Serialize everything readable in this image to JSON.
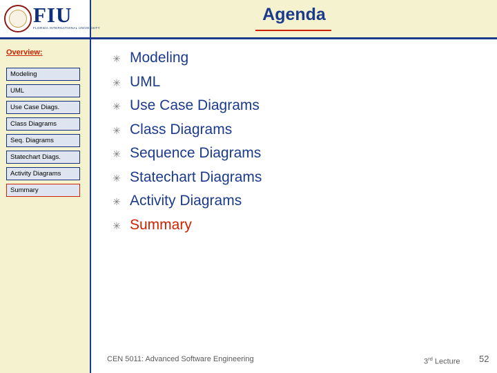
{
  "header": {
    "title": "Agenda",
    "logo": {
      "initials": "FIU",
      "subtitle": "FLORIDA INTERNATIONAL UNIVERSITY",
      "seal_name": "fiu-seal"
    }
  },
  "sidebar": {
    "heading": "Overview:",
    "items": [
      {
        "label": "Modeling",
        "current": false
      },
      {
        "label": "UML",
        "current": false
      },
      {
        "label": "Use Case Diags.",
        "current": false
      },
      {
        "label": "Class Diagrams",
        "current": false
      },
      {
        "label": "Seq. Diagrams",
        "current": false
      },
      {
        "label": "Statechart Diags.",
        "current": false
      },
      {
        "label": "Activity Diagrams",
        "current": false
      },
      {
        "label": "Summary",
        "current": true
      }
    ]
  },
  "main": {
    "bullet_glyph": "✳",
    "bullets": [
      {
        "text": "Modeling",
        "accent": false
      },
      {
        "text": "UML",
        "accent": false
      },
      {
        "text": "Use Case Diagrams",
        "accent": false
      },
      {
        "text": "Class Diagrams",
        "accent": false
      },
      {
        "text": "Sequence Diagrams",
        "accent": false
      },
      {
        "text": "Statechart Diagrams",
        "accent": false
      },
      {
        "text": "Activity Diagrams",
        "accent": false
      },
      {
        "text": "Summary",
        "accent": true
      }
    ]
  },
  "footer": {
    "course": "CEN 5011: Advanced Software Engineering",
    "lecture_number": "3",
    "lecture_ordinal": "rd",
    "lecture_label": " Lecture",
    "page_number": "52"
  },
  "colors": {
    "banner_bg": "#f5f3cf",
    "accent_blue": "#1b3a8c",
    "accent_red": "#cc2200",
    "nav_bg": "#dfe5f0"
  }
}
